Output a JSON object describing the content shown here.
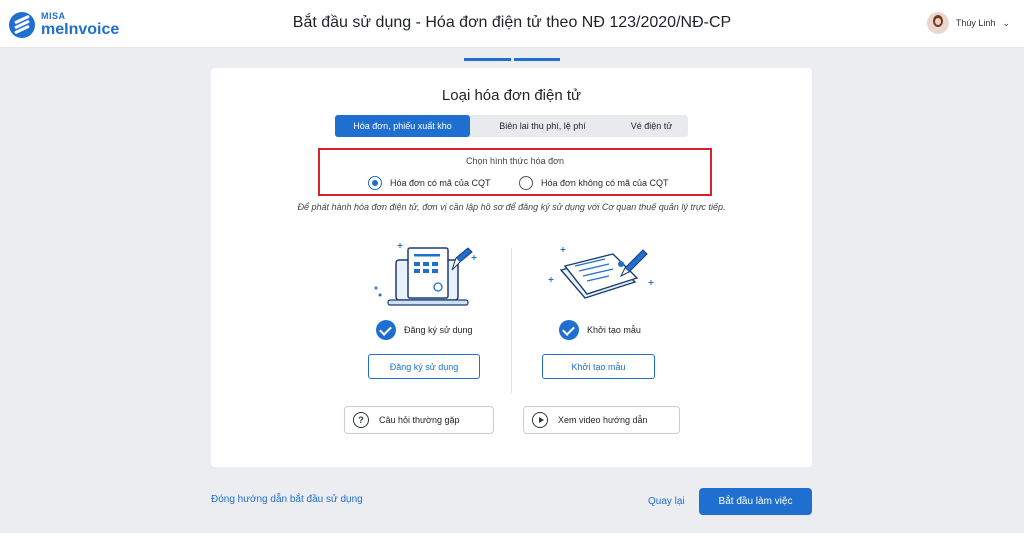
{
  "header": {
    "logo_brand": "MISA",
    "logo_product": "meInvoice",
    "title": "Bắt đầu sử dụng - Hóa đơn điện tử theo NĐ 123/2020/NĐ-CP",
    "user_name": "Thúy Linh"
  },
  "progress": {
    "steps_total": 2,
    "active_steps": 2
  },
  "card": {
    "title": "Loại hóa đơn điện tử",
    "tabs": [
      {
        "label": "Hóa đơn, phiếu xuất kho",
        "active": true
      },
      {
        "label": "Biên lai thu phí, lệ phí",
        "active": false
      },
      {
        "label": "Vé điện tử",
        "active": false
      }
    ],
    "choose": {
      "label": "Chọn hình thức hóa đơn",
      "options": [
        {
          "label": "Hóa đơn có mã của CQT",
          "checked": true
        },
        {
          "label": "Hóa đơn không có mã của CQT",
          "checked": false
        }
      ]
    },
    "note": "Để phát hành hóa đơn điện tử, đơn vị cần lập hồ sơ để đăng ký sử dụng với Cơ quan thuế quản lý trực tiếp.",
    "steps": [
      {
        "check_label": "Đăng ký sử dụng",
        "button_label": "Đăng ký sử dụng",
        "illustration": "laptop-document-icon"
      },
      {
        "check_label": "Khởi tạo mẫu",
        "button_label": "Khởi tạo mẫu",
        "illustration": "papers-pen-icon"
      }
    ],
    "help": [
      {
        "label": "Câu hỏi thường gặp",
        "icon": "question-icon"
      },
      {
        "label": "Xem video hướng dẫn",
        "icon": "play-icon"
      }
    ]
  },
  "footer": {
    "close_link": "Đóng hướng dẫn bắt đầu sử dụng",
    "back_link": "Quay lại",
    "start_button": "Bắt đầu làm việc"
  },
  "colors": {
    "primary": "#1f6fd1",
    "highlight_border": "#d6232c",
    "background": "#ebedf1"
  }
}
